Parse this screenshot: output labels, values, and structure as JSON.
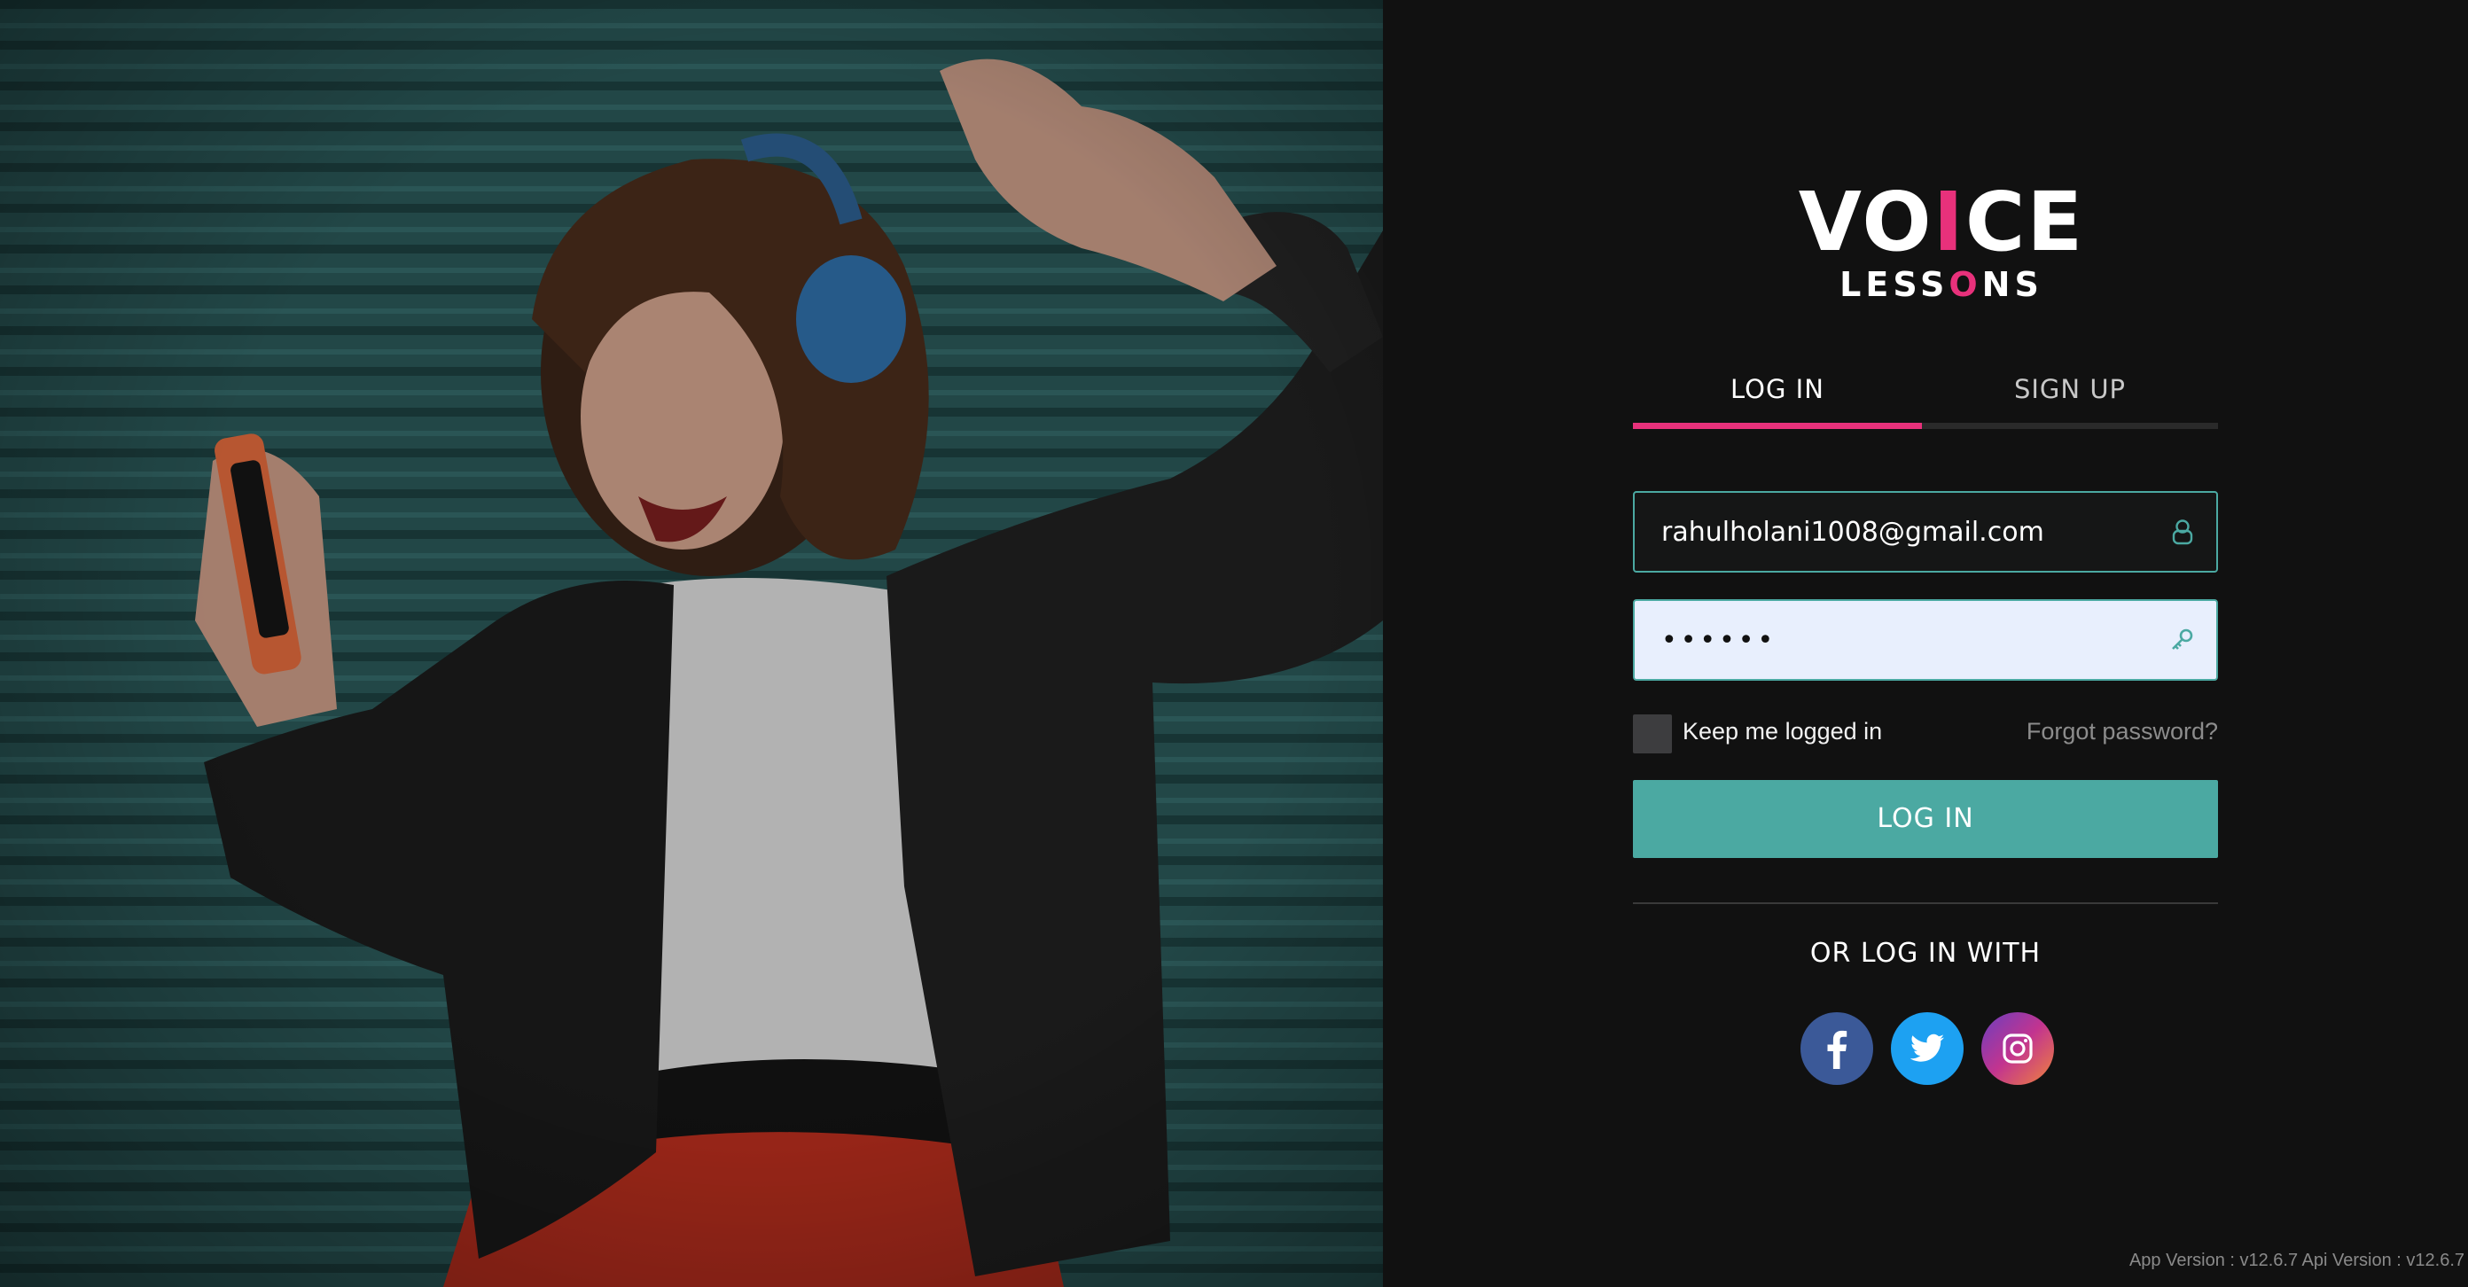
{
  "brand": {
    "logo_line1": "VOICE",
    "logo_line2": "LESSONS",
    "accent_color": "#e8317b",
    "primary_color": "#4ba9a2"
  },
  "hero": {
    "image_description": "woman-with-headphones-dancing"
  },
  "tabs": [
    {
      "label": "LOG IN",
      "active": true
    },
    {
      "label": "SIGN UP",
      "active": false
    }
  ],
  "form": {
    "email_value": "rahulholani1008@gmail.com",
    "email_icon": "user-icon",
    "password_value": "••••••",
    "password_icon": "key-icon",
    "remember_label": "Keep me logged in",
    "remember_checked": false,
    "forgot_label": "Forgot password?",
    "submit_label": "LOG IN"
  },
  "social": {
    "heading": "OR LOG IN WITH",
    "providers": [
      {
        "name": "facebook",
        "icon": "facebook-icon",
        "color": "#3b5998"
      },
      {
        "name": "twitter",
        "icon": "twitter-icon",
        "color": "#1da1f2"
      },
      {
        "name": "instagram",
        "icon": "instagram-icon",
        "color": "#c2348f"
      }
    ]
  },
  "footer": {
    "version_text": "App Version : v12.6.7 Api Version : v12.6.7"
  }
}
